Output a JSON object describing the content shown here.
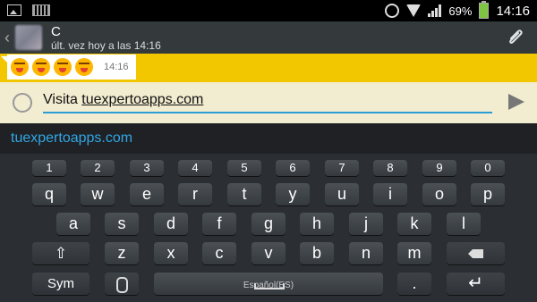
{
  "status_bar": {
    "battery": "69%",
    "time": "14:16"
  },
  "header": {
    "contact_name": "C",
    "last_seen": "últ. vez hoy a las 14:16"
  },
  "message": {
    "time": "14:16",
    "emoji_count": 4
  },
  "compose": {
    "text_prefix": "Visita ",
    "text_link": "tuexpertoapps.com"
  },
  "suggestion": {
    "text": "tuexpertoapps.com"
  },
  "keyboard": {
    "numbers": [
      "1",
      "2",
      "3",
      "4",
      "5",
      "6",
      "7",
      "8",
      "9",
      "0"
    ],
    "row1": [
      "q",
      "w",
      "e",
      "r",
      "t",
      "y",
      "u",
      "i",
      "o",
      "p"
    ],
    "row2": [
      "a",
      "s",
      "d",
      "f",
      "g",
      "h",
      "j",
      "k",
      "l"
    ],
    "row3": [
      "z",
      "x",
      "c",
      "v",
      "b",
      "n",
      "m"
    ],
    "sym_label": "Sym",
    "space_label": "Español(ES)",
    "period_label": "."
  },
  "colors": {
    "chat_background": "#f2c700",
    "link_blue": "#32a7e5"
  }
}
